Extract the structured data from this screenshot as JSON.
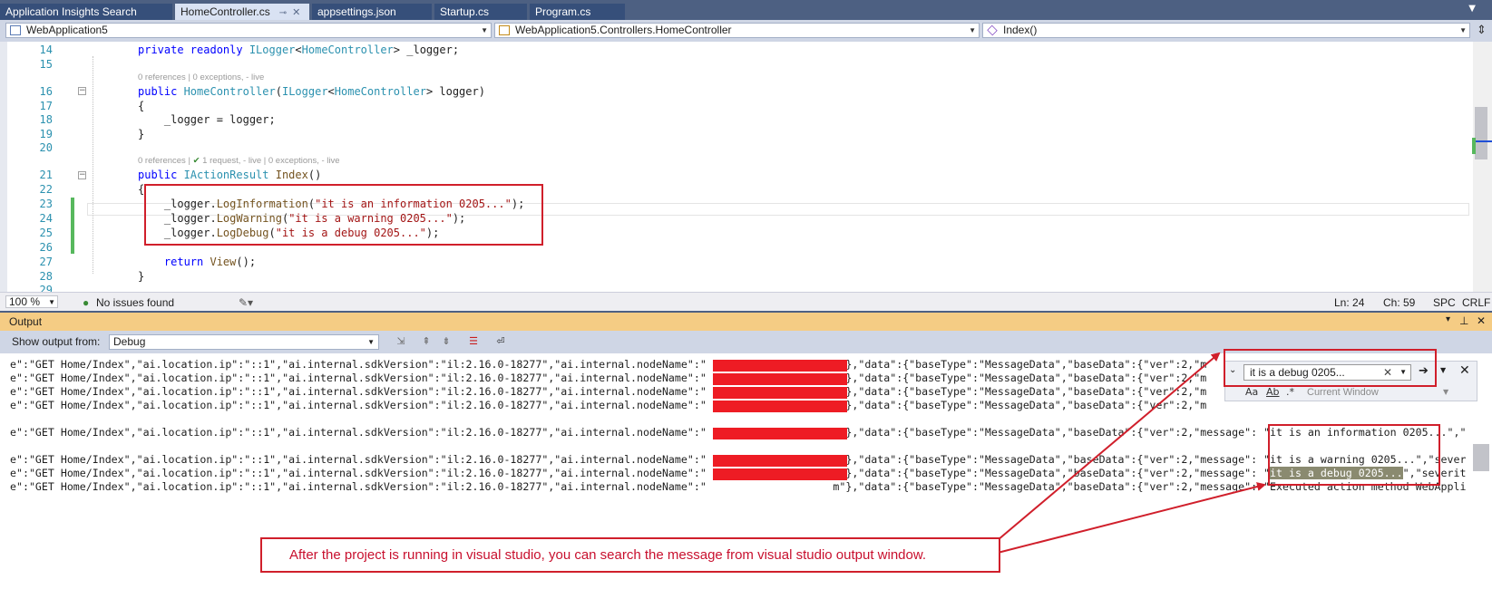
{
  "tabs": [
    {
      "label": "Application Insights Search",
      "active": false
    },
    {
      "label": "HomeController.cs",
      "active": true
    },
    {
      "label": "appsettings.json",
      "active": false
    },
    {
      "label": "Startup.cs",
      "active": false
    },
    {
      "label": "Program.cs",
      "active": false
    }
  ],
  "nav": {
    "project": "WebApplication5",
    "class": "WebApplication5.Controllers.HomeController",
    "member": "Index()"
  },
  "editor": {
    "lines": [
      {
        "num": "14",
        "tokens": [
          [
            "kw",
            "private readonly "
          ],
          [
            "ty",
            "ILogger"
          ],
          [
            "",
            "<"
          ],
          [
            "ty",
            "HomeController"
          ],
          [
            "",
            "> _logger;"
          ]
        ]
      },
      {
        "num": "15",
        "tokens": []
      },
      {
        "num": "16",
        "tokens": [
          [
            "kw",
            "public "
          ],
          [
            "ty",
            "HomeController"
          ],
          [
            "",
            "("
          ],
          [
            "ty",
            "ILogger"
          ],
          [
            "",
            "<"
          ],
          [
            "ty",
            "HomeController"
          ],
          [
            "",
            "> logger)"
          ]
        ]
      },
      {
        "num": "17",
        "tokens": [
          [
            "",
            "{"
          ]
        ]
      },
      {
        "num": "18",
        "tokens": [
          [
            "",
            "    _logger = logger;"
          ]
        ]
      },
      {
        "num": "19",
        "tokens": [
          [
            "",
            "}"
          ]
        ]
      },
      {
        "num": "20",
        "tokens": []
      },
      {
        "num": "21",
        "tokens": [
          [
            "kw",
            "public "
          ],
          [
            "ty",
            "IActionResult "
          ],
          [
            "mth",
            "Index"
          ],
          [
            "",
            "()"
          ]
        ]
      },
      {
        "num": "22",
        "tokens": [
          [
            "",
            "{"
          ]
        ]
      },
      {
        "num": "23",
        "tokens": [
          [
            "",
            "    _logger."
          ],
          [
            "mth",
            "LogInformation"
          ],
          [
            "",
            "("
          ],
          [
            "str",
            "\"it is an information 0205...\""
          ],
          [
            "",
            ");"
          ]
        ]
      },
      {
        "num": "24",
        "tokens": [
          [
            "",
            "    _logger."
          ],
          [
            "mth",
            "LogWarning"
          ],
          [
            "",
            "("
          ],
          [
            "str",
            "\"it is a warning 0205...\""
          ],
          [
            "",
            ");"
          ]
        ]
      },
      {
        "num": "25",
        "tokens": [
          [
            "",
            "    _logger."
          ],
          [
            "mth",
            "LogDebug"
          ],
          [
            "",
            "("
          ],
          [
            "str",
            "\"it is a debug 0205...\""
          ],
          [
            "",
            ");"
          ]
        ]
      },
      {
        "num": "26",
        "tokens": []
      },
      {
        "num": "27",
        "tokens": [
          [
            "",
            "    "
          ],
          [
            "kw",
            "return "
          ],
          [
            "mth",
            "View"
          ],
          [
            "",
            "();"
          ]
        ]
      },
      {
        "num": "28",
        "tokens": [
          [
            "",
            "}"
          ]
        ]
      },
      {
        "num": "29",
        "tokens": []
      }
    ],
    "lens1": "0 references | 0 exceptions, - live",
    "lens2a": "0 references | ",
    "lens2b": "1 request, - live",
    "lens2c": " | 0 exceptions, - live"
  },
  "status": {
    "zoom": "100 %",
    "issues": "No issues found",
    "ln": "Ln: 24",
    "ch": "Ch: 59",
    "spc": "SPC",
    "crlf": "CRLF"
  },
  "output": {
    "title": "Output",
    "show_from_label": "Show output from:",
    "source": "Debug",
    "line_prefix": "e\":\"GET Home/Index\",\"ai.location.ip\":\"::1\",\"ai.internal.sdkVersion\":\"il:2.16.0-18277\",\"ai.internal.nodeName\":\"",
    "line_mid": "                    m\"},\"data\":{\"baseType\":\"MessageData\",\"baseData\":{\"ver\":2,\"m",
    "line_full_mid": "                    m\"},\"data\":{\"baseType\":\"MessageData\",\"baseData\":{\"ver\":2,\"message\": \"",
    "msg_info": "it is an information 0205...\",\"",
    "msg_warn": "it is a warning 0205...\",\"sever",
    "msg_debug": "it is a debug 0205...",
    "msg_debug_tail": "\",\"severit",
    "msg_exec": "Executed action method WebAppli"
  },
  "find": {
    "query": "it is a debug 0205...",
    "scope": "Current Window",
    "opt_case": "Aa",
    "opt_word": "Ab",
    "opt_regex": ".*"
  },
  "annotation": {
    "text": "After the project is running in visual studio, you can search the message from visual studio output window."
  },
  "colors": {
    "tab_strip": "#4d6082",
    "accent_red": "#d01f2b",
    "output_header": "#f5cc84"
  }
}
